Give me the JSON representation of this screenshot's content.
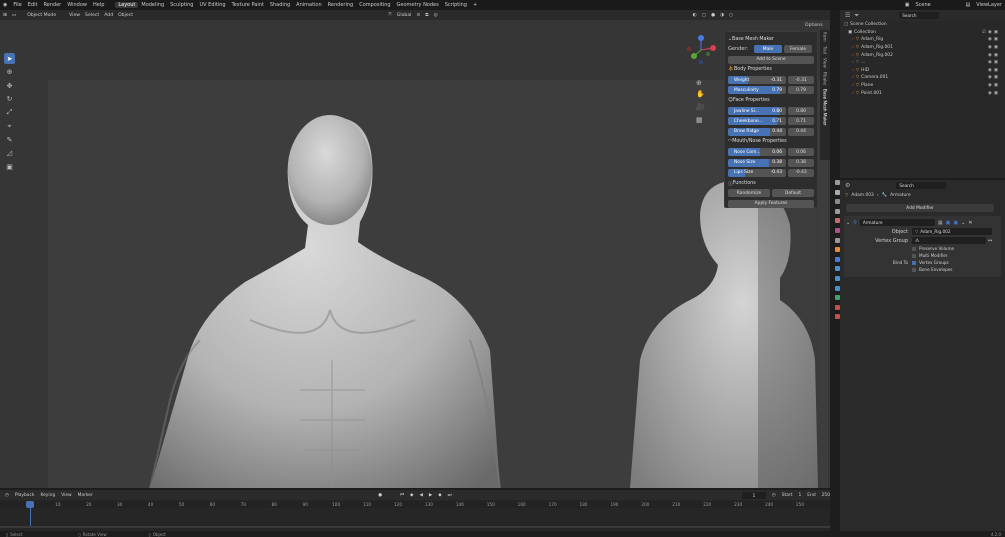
{
  "menu": {
    "items": [
      "File",
      "Edit",
      "Render",
      "Window",
      "Help"
    ],
    "workspaces": [
      "Layout",
      "Modeling",
      "Sculpting",
      "UV Editing",
      "Texture Paint",
      "Shading",
      "Animation",
      "Rendering",
      "Compositing",
      "Geometry Nodes",
      "Scripting"
    ],
    "active_workspace": "Layout",
    "scene": "Scene",
    "view_layer": "ViewLayer"
  },
  "viewport_header": {
    "mode": "Object Mode",
    "menus": [
      "View",
      "Select",
      "Add",
      "Object"
    ],
    "transform": "Global",
    "options": "Options"
  },
  "npanel_tabs": [
    "Item",
    "Tool",
    "View",
    "Rbake",
    "Base Mesh Maker"
  ],
  "base_mesh_maker": {
    "title": "Base Mesh Maker",
    "gender_label": "Gender:",
    "male": "Male",
    "female": "Female",
    "add_to_scene": "Add to Scene",
    "body_header": "Body Properties",
    "body": [
      {
        "label": "Weight",
        "value": "-0.31",
        "field": "-0.31",
        "fill": 0.35
      },
      {
        "label": "Masculinity",
        "value": "0.79",
        "field": "0.79",
        "fill": 0.9
      }
    ],
    "face_header": "Face Properties",
    "face": [
      {
        "label": "Jawline Si...",
        "value": "0.80",
        "field": "0.80",
        "fill": 0.9
      },
      {
        "label": "Cheekbone...",
        "value": "0.71",
        "field": "0.71",
        "fill": 0.85
      },
      {
        "label": "Brow Ridge",
        "value": "0.44",
        "field": "0.44",
        "fill": 0.72
      }
    ],
    "mouth_header": "Mouth/Nose Properties",
    "mouth": [
      {
        "label": "Nose Com...",
        "value": "0.06",
        "field": "0.06",
        "fill": 0.55
      },
      {
        "label": "Nose Size",
        "value": "0.38",
        "field": "0.38",
        "fill": 0.7
      },
      {
        "label": "Lips Size",
        "value": "-0.43",
        "field": "-0.43",
        "fill": 0.3
      }
    ],
    "functions_header": "Functions",
    "randomize": "Randomize",
    "default": "Default",
    "apply": "Apply Features"
  },
  "outliner": {
    "search_placeholder": "Search",
    "scene_collection": "Scene Collection",
    "collection": "Collection",
    "items": [
      {
        "name": "Adam_Rig",
        "icon_color": "#e28c3c"
      },
      {
        "name": "Adam_Rig.001",
        "icon_color": "#e28c3c"
      },
      {
        "name": "Adam_Rig.002",
        "icon_color": "#e28c3c"
      },
      {
        "name": "...",
        "icon_color": "#777777"
      },
      {
        "name": "HID",
        "icon_color": "#e28c3c"
      },
      {
        "name": "Camera.001",
        "icon_color": "#e28c3c"
      },
      {
        "name": "Plane",
        "icon_color": "#e28c3c"
      },
      {
        "name": "Point.001",
        "icon_color": "#e28c3c"
      }
    ]
  },
  "properties": {
    "search_placeholder": "Search",
    "breadcrumb_object": "Adam.003",
    "breadcrumb_modifier": "Armature",
    "add_modifier": "Add Modifier",
    "modifier_name": "Armature",
    "object_label": "Object",
    "object_value": "Adam_Rig.002",
    "vertex_group_label": "Vertex Group",
    "preserve_volume": "Preserve Volume",
    "multi_modifier": "Multi Modifier",
    "bind_to": "Bind To",
    "vertex_groups": "Vertex Groups",
    "bone_envelopes": "Bone Envelopes"
  },
  "timeline": {
    "menus": [
      "Playback",
      "Keying",
      "View",
      "Marker"
    ],
    "current_frame": "1",
    "start_label": "Start",
    "start": "1",
    "end_label": "End",
    "end": "250",
    "ticks": [
      "1",
      "10",
      "20",
      "30",
      "40",
      "50",
      "60",
      "70",
      "80",
      "90",
      "100",
      "110",
      "120",
      "130",
      "140",
      "150",
      "160",
      "170",
      "180",
      "190",
      "200",
      "210",
      "220",
      "230",
      "240",
      "250"
    ]
  },
  "statusbar": {
    "select": "Select",
    "rotate": "Rotate View",
    "object": "Object",
    "version": "4.2.0"
  },
  "colors": {
    "accent": "#4772b3",
    "panel": "#2d2d2d",
    "viewport": "#363636"
  }
}
